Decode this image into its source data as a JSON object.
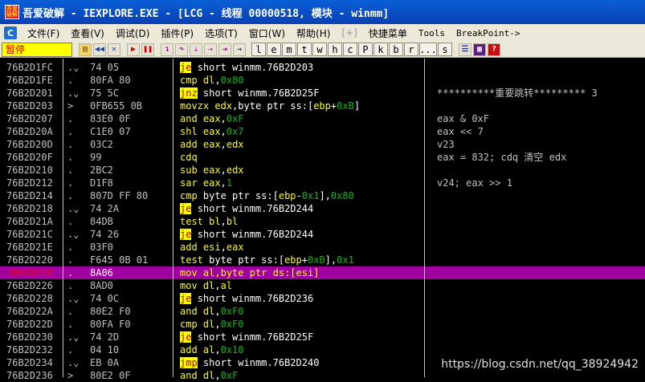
{
  "window": {
    "title": "吾爱破解 - IEXPLORE.EXE - [LCG - 线程 00000518, 模块 - winmm]"
  },
  "menu": {
    "items": [
      "文件(F)",
      "查看(V)",
      "调试(D)",
      "插件(P)",
      "选项(T)",
      "窗口(W)",
      "帮助(H)",
      "[+]",
      "快捷菜单",
      "Tools",
      "BreakPoint->"
    ]
  },
  "toolbar": {
    "status": "暂停",
    "letters": [
      "l",
      "e",
      "m",
      "t",
      "w",
      "h",
      "c",
      "P",
      "k",
      "b",
      "r",
      "...",
      "s"
    ]
  },
  "rows": [
    {
      "addr": "76B2D1FC",
      "mark": ".v",
      "hex": "74 05",
      "mn": "je",
      "ops": "short winmm.76B2D203",
      "jump": true
    },
    {
      "addr": "76B2D1FE",
      "mark": ".",
      "hex": "80FA 80",
      "mn": "cmp",
      "ops": "dl,0x80"
    },
    {
      "addr": "76B2D201",
      "mark": ".v",
      "hex": "75 5C",
      "mn": "jnz",
      "ops": "short winmm.76B2D25F",
      "jump": true
    },
    {
      "addr": "76B2D203",
      "mark": ">",
      "hex": "0FB655 0B",
      "mn": "movzx",
      "ops": "edx,byte ptr ss:[ebp+0xB]"
    },
    {
      "addr": "76B2D207",
      "mark": ".",
      "hex": "83E0 0F",
      "mn": "and",
      "ops": "eax,0xF"
    },
    {
      "addr": "76B2D20A",
      "mark": ".",
      "hex": "C1E0 07",
      "mn": "shl",
      "ops": "eax,0x7"
    },
    {
      "addr": "76B2D20D",
      "mark": ".",
      "hex": "03C2",
      "mn": "add",
      "ops": "eax,edx"
    },
    {
      "addr": "76B2D20F",
      "mark": ".",
      "hex": "99",
      "mn": "cdq",
      "ops": ""
    },
    {
      "addr": "76B2D210",
      "mark": ".",
      "hex": "2BC2",
      "mn": "sub",
      "ops": "eax,edx"
    },
    {
      "addr": "76B2D212",
      "mark": ".",
      "hex": "D1F8",
      "mn": "sar",
      "ops": "eax,1"
    },
    {
      "addr": "76B2D214",
      "mark": ".",
      "hex": "807D FF 80",
      "mn": "cmp",
      "ops": "byte ptr ss:[ebp-0x1],0x80"
    },
    {
      "addr": "76B2D218",
      "mark": ".v",
      "hex": "74 2A",
      "mn": "je",
      "ops": "short winmm.76B2D244",
      "jump": true
    },
    {
      "addr": "76B2D21A",
      "mark": ".",
      "hex": "84DB",
      "mn": "test",
      "ops": "bl,bl"
    },
    {
      "addr": "76B2D21C",
      "mark": ".v",
      "hex": "74 26",
      "mn": "je",
      "ops": "short winmm.76B2D244",
      "jump": true
    },
    {
      "addr": "76B2D21E",
      "mark": ".",
      "hex": "03F0",
      "mn": "add",
      "ops": "esi,eax"
    },
    {
      "addr": "76B2D220",
      "mark": ".",
      "hex": "F645 0B 01",
      "mn": "test",
      "ops": "byte ptr ss:[ebp+0xB],0x1"
    },
    {
      "addr": "76B2D224",
      "mark": ".",
      "hex": "8A06",
      "mn": "mov",
      "ops": "al,byte ptr ds:[esi]",
      "selected": true
    },
    {
      "addr": "76B2D226",
      "mark": ".",
      "hex": "8AD0",
      "mn": "mov",
      "ops": "dl,al"
    },
    {
      "addr": "76B2D228",
      "mark": ".v",
      "hex": "74 0C",
      "mn": "je",
      "ops": "short winmm.76B2D236",
      "jump": true
    },
    {
      "addr": "76B2D22A",
      "mark": ".",
      "hex": "80E2 F0",
      "mn": "and",
      "ops": "dl,0xF0"
    },
    {
      "addr": "76B2D22D",
      "mark": ".",
      "hex": "80FA F0",
      "mn": "cmp",
      "ops": "dl,0xF0"
    },
    {
      "addr": "76B2D230",
      "mark": ".v",
      "hex": "74 2D",
      "mn": "je",
      "ops": "short winmm.76B2D25F",
      "jump": true
    },
    {
      "addr": "76B2D232",
      "mark": ".",
      "hex": "04 10",
      "mn": "add",
      "ops": "al,0x10"
    },
    {
      "addr": "76B2D234",
      "mark": ".v",
      "hex": "EB 0A",
      "mn": "jmp",
      "ops": "short winmm.76B2D240",
      "jump": true
    },
    {
      "addr": "76B2D236",
      "mark": ">",
      "hex": "80E2 0F",
      "mn": "and",
      "ops": "dl,0xF"
    }
  ],
  "comments": [
    {
      "row": 2,
      "text": "**********重要跳转********* 3"
    },
    {
      "row": 4,
      "text": "eax & 0xF"
    },
    {
      "row": 5,
      "text": "eax << 7"
    },
    {
      "row": 6,
      "text": "v23"
    },
    {
      "row": 7,
      "text": "eax = 832; cdq 清空 edx"
    },
    {
      "row": 9,
      "text": "v24; eax >> 1"
    }
  ],
  "watermark": "https://blog.csdn.net/qq_38924942",
  "colors": {
    "selected_row": "#a000a0",
    "mnemonic": "#ffff00",
    "jump_bg": "#ffff00",
    "jump_fg": "#c00000",
    "number": "#00c000"
  }
}
